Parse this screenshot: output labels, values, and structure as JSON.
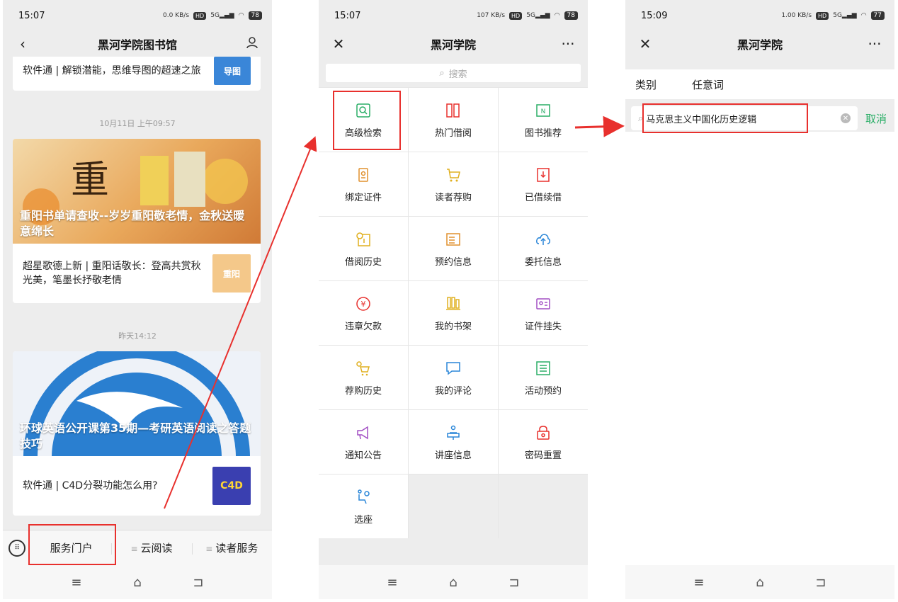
{
  "panel1": {
    "status_time": "15:07",
    "battery": "78",
    "nav_title": "黑河学院图书馆",
    "back_icon": "chevron-left-icon",
    "user_icon": "user-icon",
    "partial_card_text": "软件通 | 解锁潜能，思维导图的超速之旅",
    "partial_thumb_label": "导图",
    "timestamp1": "10月11日 上午09:57",
    "article1_caption": "重阳书单请查收--岁岁重阳敬老情，金秋送暖意绵长",
    "article1_sub": "超星歌德上新 | 重阳话敬长：登高共赏秋光美，笔墨长抒敬老情",
    "article1_thumb_label": "重阳",
    "timestamp2": "昨天14:12",
    "article2_caption": "环球英语公开课第35期—考研英语阅读之答题技巧",
    "article2_sub": "软件通 | C4D分裂功能怎么用?",
    "article2_thumb_label": "C4D",
    "tabs": [
      "服务门户",
      "云阅读",
      "读者服务"
    ]
  },
  "panel2": {
    "status_time": "15:07",
    "battery": "78",
    "nav_title": "黑河学院",
    "search_placeholder": "搜索",
    "menu": [
      {
        "label": "高级检索",
        "icon": "advanced-search-icon",
        "color": "#2aae67"
      },
      {
        "label": "热门借阅",
        "icon": "books-icon",
        "color": "#e8302d"
      },
      {
        "label": "图书推荐",
        "icon": "book-n-icon",
        "color": "#2aae67"
      },
      {
        "label": "绑定证件",
        "icon": "id-badge-icon",
        "color": "#e0902d"
      },
      {
        "label": "读者荐购",
        "icon": "cart-icon",
        "color": "#e0b020"
      },
      {
        "label": "已借续借",
        "icon": "renew-icon",
        "color": "#e8302d"
      },
      {
        "label": "借阅历史",
        "icon": "history-icon",
        "color": "#e0b020"
      },
      {
        "label": "预约信息",
        "icon": "reserve-list-icon",
        "color": "#e0902d"
      },
      {
        "label": "委托信息",
        "icon": "cloud-upload-icon",
        "color": "#2a86d8"
      },
      {
        "label": "违章欠款",
        "icon": "yen-icon",
        "color": "#e8302d"
      },
      {
        "label": "我的书架",
        "icon": "bookshelf-icon",
        "color": "#e0b020"
      },
      {
        "label": "证件挂失",
        "icon": "card-lost-icon",
        "color": "#a24fc4"
      },
      {
        "label": "荐购历史",
        "icon": "cart-history-icon",
        "color": "#e0b020"
      },
      {
        "label": "我的评论",
        "icon": "comment-icon",
        "color": "#2a86d8"
      },
      {
        "label": "活动预约",
        "icon": "activity-list-icon",
        "color": "#2aae67"
      },
      {
        "label": "通知公告",
        "icon": "megaphone-icon",
        "color": "#a24fc4"
      },
      {
        "label": "讲座信息",
        "icon": "lecture-icon",
        "color": "#2a86d8"
      },
      {
        "label": "密码重置",
        "icon": "lock-icon",
        "color": "#e8302d"
      },
      {
        "label": "选座",
        "icon": "seat-icon",
        "color": "#2a86d8"
      }
    ]
  },
  "panel3": {
    "status_time": "15:09",
    "battery": "77",
    "nav_title": "黑河学院",
    "filter_category": "类别",
    "filter_keyword": "任意词",
    "search_value": "马克思主义中国化历史逻辑",
    "cancel_label": "取消"
  },
  "colors": {
    "accent_red": "#e8302d",
    "accent_green": "#2aae67"
  }
}
